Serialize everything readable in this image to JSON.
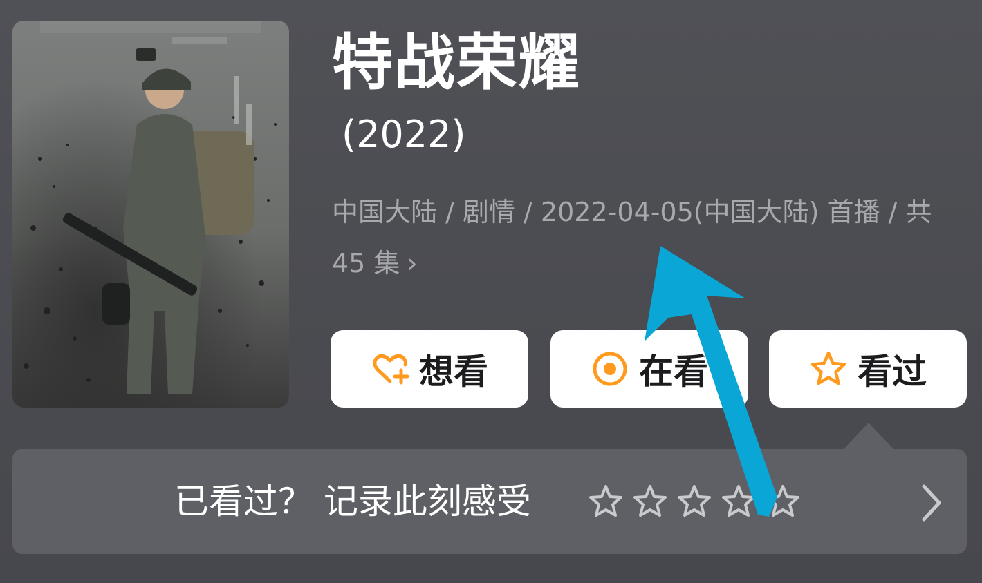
{
  "show": {
    "title": "特战荣耀",
    "year": "(2022)",
    "meta": "中国大陆 / 剧情 / 2022-04-05(中国大陆) 首播 / 共 45 集",
    "meta_chevron": "›"
  },
  "actions": {
    "want_label": "想看",
    "watching_label": "在看",
    "watched_label": "看过"
  },
  "rating": {
    "prompt": "已看过？ 记录此刻感受",
    "stars": 0,
    "max_stars": 5
  },
  "colors": {
    "accent": "#ff9a1f",
    "annotation_arrow": "#0aa6d6",
    "background": "#4b4c51",
    "panel": "#5f6065"
  },
  "icons": {
    "want": "heart-plus-icon",
    "watching": "target-circle-icon",
    "watched": "star-outline-icon",
    "panel_more": "chevron-right-icon"
  }
}
